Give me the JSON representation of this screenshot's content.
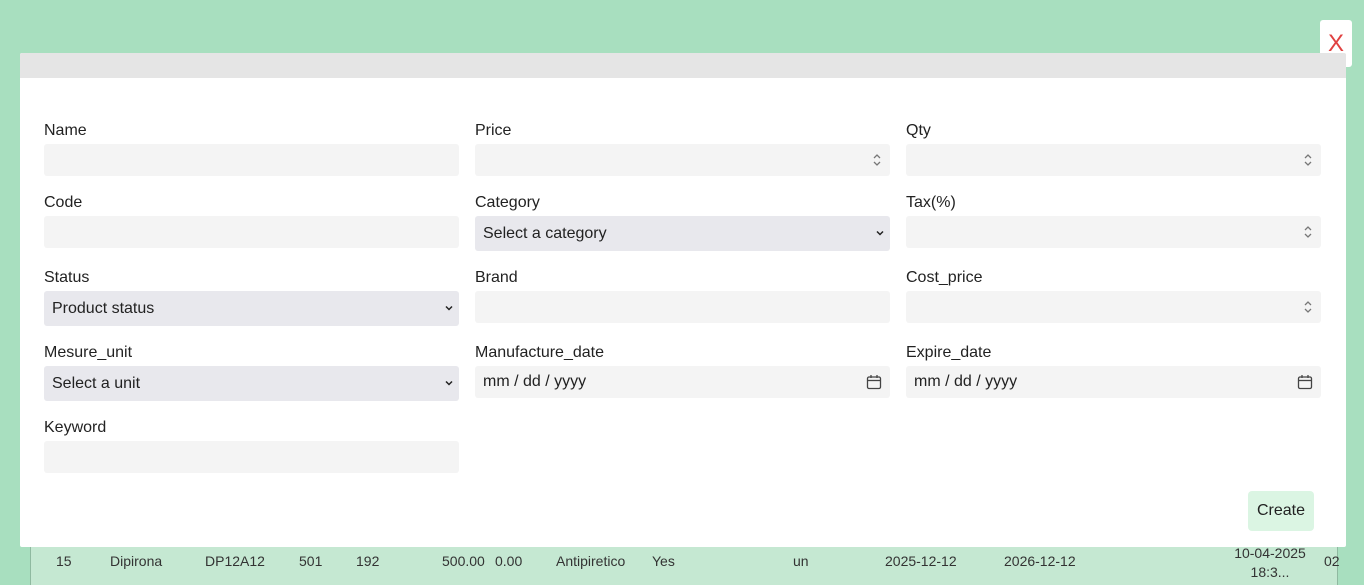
{
  "modal": {
    "close_label": "X",
    "create_label": "Create",
    "fields": {
      "name": {
        "label": "Name",
        "value": ""
      },
      "price": {
        "label": "Price",
        "value": ""
      },
      "qty": {
        "label": "Qty",
        "value": ""
      },
      "code": {
        "label": "Code",
        "value": ""
      },
      "category": {
        "label": "Category",
        "selected": "Select a category"
      },
      "tax": {
        "label": "Tax(%)",
        "value": ""
      },
      "status": {
        "label": "Status",
        "selected": "Product status"
      },
      "brand": {
        "label": "Brand",
        "value": ""
      },
      "cost_price": {
        "label": "Cost_price",
        "value": ""
      },
      "mesure_unit": {
        "label": "Mesure_unit",
        "selected": "Select a unit"
      },
      "manufacture_date": {
        "label": "Manufacture_date",
        "placeholder": "mm / dd / yyyy"
      },
      "expire_date": {
        "label": "Expire_date",
        "placeholder": "mm / dd / yyyy"
      },
      "keyword": {
        "label": "Keyword",
        "value": ""
      }
    }
  },
  "background_table": {
    "row": [
      "15",
      "Dipirona",
      "DP12A12",
      "501",
      "192",
      "500.00",
      "0.00",
      "Antipiretico",
      "Yes",
      "un",
      "2025-12-12",
      "2026-12-12",
      "10-04-2025 18:3...",
      "02"
    ]
  }
}
